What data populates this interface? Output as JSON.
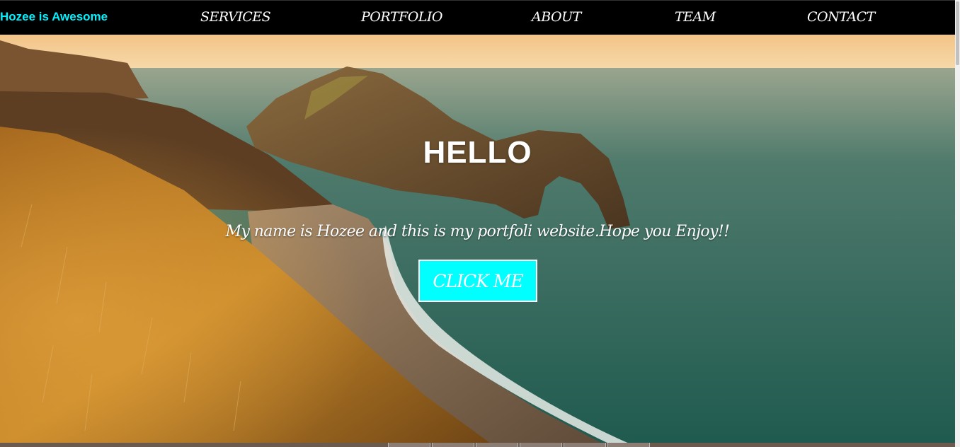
{
  "navbar": {
    "brand": "Hozee is Awesome",
    "links": [
      "SERVICES",
      "PORTFOLIO",
      "ABOUT",
      "TEAM",
      "CONTACT"
    ]
  },
  "hero": {
    "heading": "HELLO",
    "tagline": "My name is Hozee and this is my portfoli website.Hope you Enjoy!!",
    "button_label": "CLICK ME"
  },
  "colors": {
    "brand": "#00f2ff",
    "button_bg": "#00ffff",
    "navbar_bg": "#000000"
  }
}
